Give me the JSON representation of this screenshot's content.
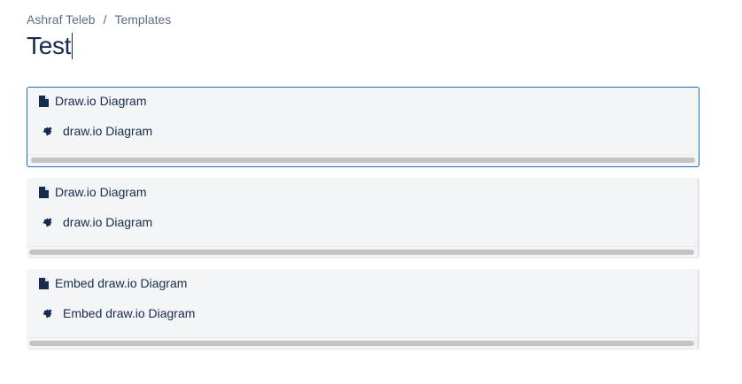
{
  "breadcrumb": {
    "items": [
      "Ashraf Teleb",
      "Templates"
    ],
    "separator": "/"
  },
  "page": {
    "title": "Test"
  },
  "macros": [
    {
      "header_label": "Draw.io Diagram",
      "body_label": "draw.io Diagram",
      "selected": true
    },
    {
      "header_label": "Draw.io Diagram",
      "body_label": "draw.io Diagram",
      "selected": false
    },
    {
      "header_label": "Embed draw.io Diagram",
      "body_label": "Embed draw.io Diagram",
      "selected": false
    }
  ],
  "icons": {
    "header": "document-icon",
    "body": "puzzle-piece-icon"
  },
  "colors": {
    "text": "#172b4d",
    "muted": "#5e6c84",
    "selection_border": "#1d6fc6",
    "macro_bg": "#f4f5f7",
    "scroll_thumb": "#c4c4c4"
  }
}
